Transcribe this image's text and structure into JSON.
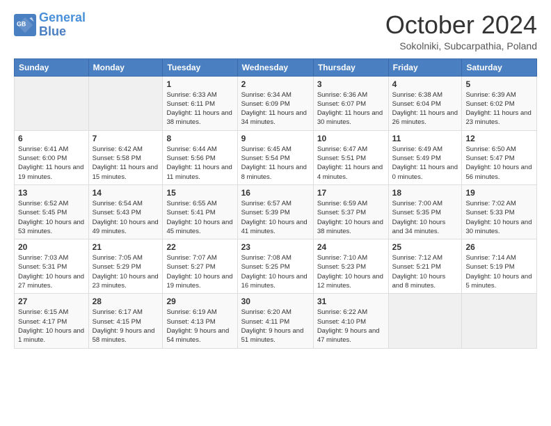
{
  "header": {
    "logo_line1": "General",
    "logo_line2": "Blue",
    "month": "October 2024",
    "location": "Sokolniki, Subcarpathia, Poland"
  },
  "weekdays": [
    "Sunday",
    "Monday",
    "Tuesday",
    "Wednesday",
    "Thursday",
    "Friday",
    "Saturday"
  ],
  "weeks": [
    [
      {
        "day": "",
        "info": ""
      },
      {
        "day": "",
        "info": ""
      },
      {
        "day": "1",
        "info": "Sunrise: 6:33 AM\nSunset: 6:11 PM\nDaylight: 11 hours and 38 minutes."
      },
      {
        "day": "2",
        "info": "Sunrise: 6:34 AM\nSunset: 6:09 PM\nDaylight: 11 hours and 34 minutes."
      },
      {
        "day": "3",
        "info": "Sunrise: 6:36 AM\nSunset: 6:07 PM\nDaylight: 11 hours and 30 minutes."
      },
      {
        "day": "4",
        "info": "Sunrise: 6:38 AM\nSunset: 6:04 PM\nDaylight: 11 hours and 26 minutes."
      },
      {
        "day": "5",
        "info": "Sunrise: 6:39 AM\nSunset: 6:02 PM\nDaylight: 11 hours and 23 minutes."
      }
    ],
    [
      {
        "day": "6",
        "info": "Sunrise: 6:41 AM\nSunset: 6:00 PM\nDaylight: 11 hours and 19 minutes."
      },
      {
        "day": "7",
        "info": "Sunrise: 6:42 AM\nSunset: 5:58 PM\nDaylight: 11 hours and 15 minutes."
      },
      {
        "day": "8",
        "info": "Sunrise: 6:44 AM\nSunset: 5:56 PM\nDaylight: 11 hours and 11 minutes."
      },
      {
        "day": "9",
        "info": "Sunrise: 6:45 AM\nSunset: 5:54 PM\nDaylight: 11 hours and 8 minutes."
      },
      {
        "day": "10",
        "info": "Sunrise: 6:47 AM\nSunset: 5:51 PM\nDaylight: 11 hours and 4 minutes."
      },
      {
        "day": "11",
        "info": "Sunrise: 6:49 AM\nSunset: 5:49 PM\nDaylight: 11 hours and 0 minutes."
      },
      {
        "day": "12",
        "info": "Sunrise: 6:50 AM\nSunset: 5:47 PM\nDaylight: 10 hours and 56 minutes."
      }
    ],
    [
      {
        "day": "13",
        "info": "Sunrise: 6:52 AM\nSunset: 5:45 PM\nDaylight: 10 hours and 53 minutes."
      },
      {
        "day": "14",
        "info": "Sunrise: 6:54 AM\nSunset: 5:43 PM\nDaylight: 10 hours and 49 minutes."
      },
      {
        "day": "15",
        "info": "Sunrise: 6:55 AM\nSunset: 5:41 PM\nDaylight: 10 hours and 45 minutes."
      },
      {
        "day": "16",
        "info": "Sunrise: 6:57 AM\nSunset: 5:39 PM\nDaylight: 10 hours and 41 minutes."
      },
      {
        "day": "17",
        "info": "Sunrise: 6:59 AM\nSunset: 5:37 PM\nDaylight: 10 hours and 38 minutes."
      },
      {
        "day": "18",
        "info": "Sunrise: 7:00 AM\nSunset: 5:35 PM\nDaylight: 10 hours and 34 minutes."
      },
      {
        "day": "19",
        "info": "Sunrise: 7:02 AM\nSunset: 5:33 PM\nDaylight: 10 hours and 30 minutes."
      }
    ],
    [
      {
        "day": "20",
        "info": "Sunrise: 7:03 AM\nSunset: 5:31 PM\nDaylight: 10 hours and 27 minutes."
      },
      {
        "day": "21",
        "info": "Sunrise: 7:05 AM\nSunset: 5:29 PM\nDaylight: 10 hours and 23 minutes."
      },
      {
        "day": "22",
        "info": "Sunrise: 7:07 AM\nSunset: 5:27 PM\nDaylight: 10 hours and 19 minutes."
      },
      {
        "day": "23",
        "info": "Sunrise: 7:08 AM\nSunset: 5:25 PM\nDaylight: 10 hours and 16 minutes."
      },
      {
        "day": "24",
        "info": "Sunrise: 7:10 AM\nSunset: 5:23 PM\nDaylight: 10 hours and 12 minutes."
      },
      {
        "day": "25",
        "info": "Sunrise: 7:12 AM\nSunset: 5:21 PM\nDaylight: 10 hours and 8 minutes."
      },
      {
        "day": "26",
        "info": "Sunrise: 7:14 AM\nSunset: 5:19 PM\nDaylight: 10 hours and 5 minutes."
      }
    ],
    [
      {
        "day": "27",
        "info": "Sunrise: 6:15 AM\nSunset: 4:17 PM\nDaylight: 10 hours and 1 minute."
      },
      {
        "day": "28",
        "info": "Sunrise: 6:17 AM\nSunset: 4:15 PM\nDaylight: 9 hours and 58 minutes."
      },
      {
        "day": "29",
        "info": "Sunrise: 6:19 AM\nSunset: 4:13 PM\nDaylight: 9 hours and 54 minutes."
      },
      {
        "day": "30",
        "info": "Sunrise: 6:20 AM\nSunset: 4:11 PM\nDaylight: 9 hours and 51 minutes."
      },
      {
        "day": "31",
        "info": "Sunrise: 6:22 AM\nSunset: 4:10 PM\nDaylight: 9 hours and 47 minutes."
      },
      {
        "day": "",
        "info": ""
      },
      {
        "day": "",
        "info": ""
      }
    ]
  ]
}
